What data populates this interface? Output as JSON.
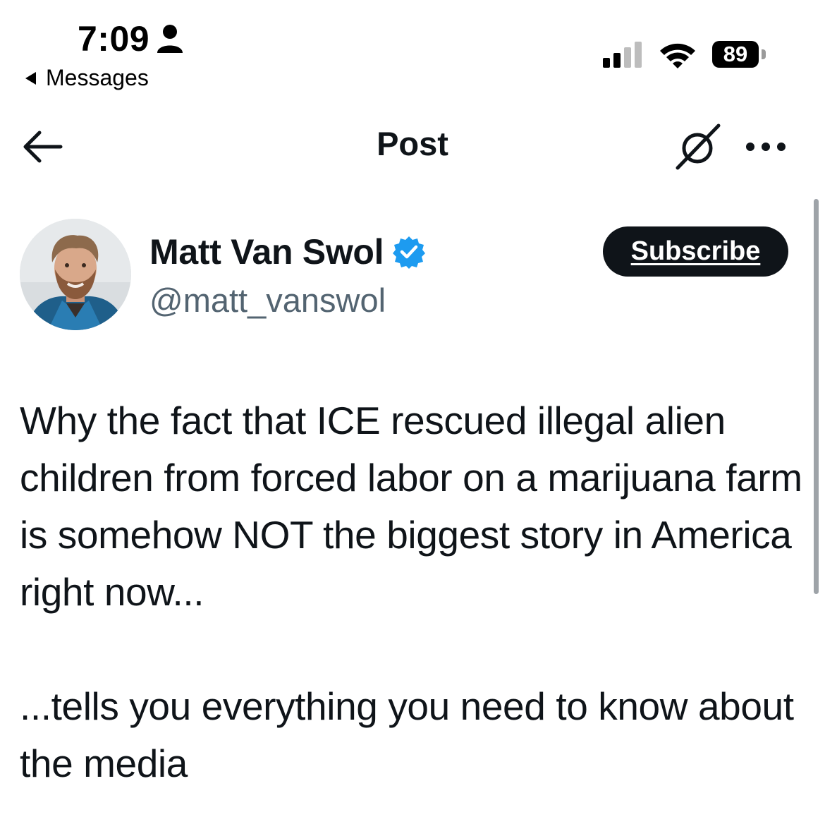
{
  "status_bar": {
    "time": "7:09",
    "back_app": "Messages",
    "battery": "89",
    "signal_icon": "cellular-signal-icon",
    "wifi_icon": "wifi-icon",
    "person_icon": "person-icon"
  },
  "header": {
    "title": "Post",
    "back_icon": "back-arrow-icon",
    "grok_icon": "grok-icon",
    "more_icon": "more-ellipsis-icon"
  },
  "author": {
    "name": "Matt Van Swol",
    "handle": "@matt_vanswol",
    "verified": true,
    "verified_color": "#1d9bf0",
    "subscribe_label": "Subscribe"
  },
  "post": {
    "paragraphs": [
      "Why the fact that ICE rescued illegal alien children from forced labor on a marijuana farm is somehow NOT the biggest story in America right now...",
      "...tells you everything you need to know about the media"
    ]
  },
  "colors": {
    "text_primary": "#0f1419",
    "text_secondary": "#536471",
    "button_bg": "#0f1419",
    "verified_blue": "#1d9bf0"
  }
}
